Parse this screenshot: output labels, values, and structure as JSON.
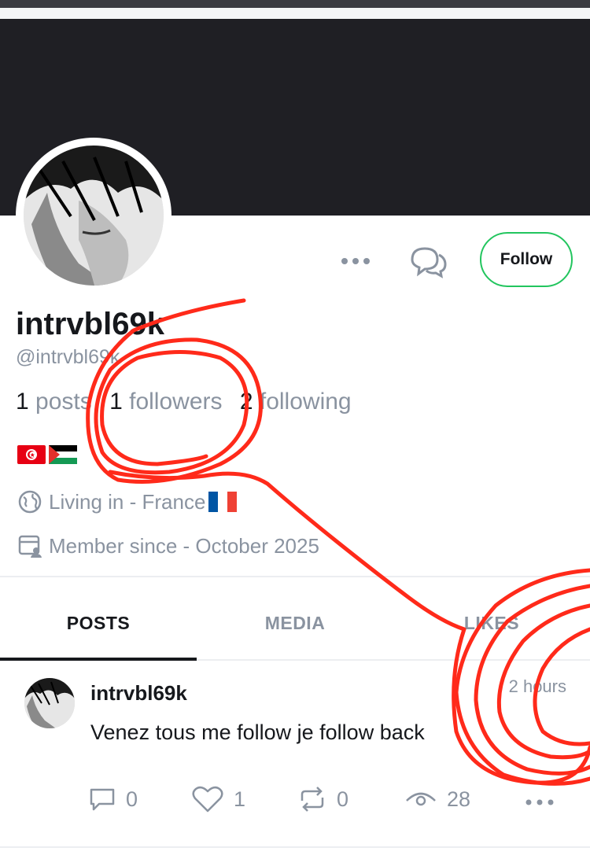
{
  "profile": {
    "display_name": "intrvbl69k",
    "handle": "@intrvbl69k",
    "follow_label": "Follow",
    "stats": {
      "posts_count": "1",
      "posts_label": "posts",
      "followers_count": "1",
      "followers_label": "followers",
      "following_count": "2",
      "following_label": "following"
    },
    "bio_flags": [
      "tunisia-flag",
      "palestine-flag"
    ],
    "location": "Living in - France",
    "member_since": "Member since - October 2025"
  },
  "tabs": [
    {
      "label": "POSTS",
      "active": true
    },
    {
      "label": "MEDIA",
      "active": false
    },
    {
      "label": "LIKES",
      "active": false
    }
  ],
  "post": {
    "author": "intrvbl69k",
    "time": "2 hours",
    "text": "Venez tous me follow je follow back",
    "replies": "0",
    "likes": "1",
    "reposts": "0",
    "views": "28"
  },
  "colors": {
    "accent_green": "#22c55e",
    "banner": "#1f1f24",
    "muted_text": "#8a93a0",
    "annotation_red": "#ff2a1a"
  },
  "icons": [
    "more-dots-icon",
    "message-icon",
    "globe-icon",
    "calendar-user-icon",
    "reply-icon",
    "heart-icon",
    "repost-icon",
    "eye-icon"
  ]
}
